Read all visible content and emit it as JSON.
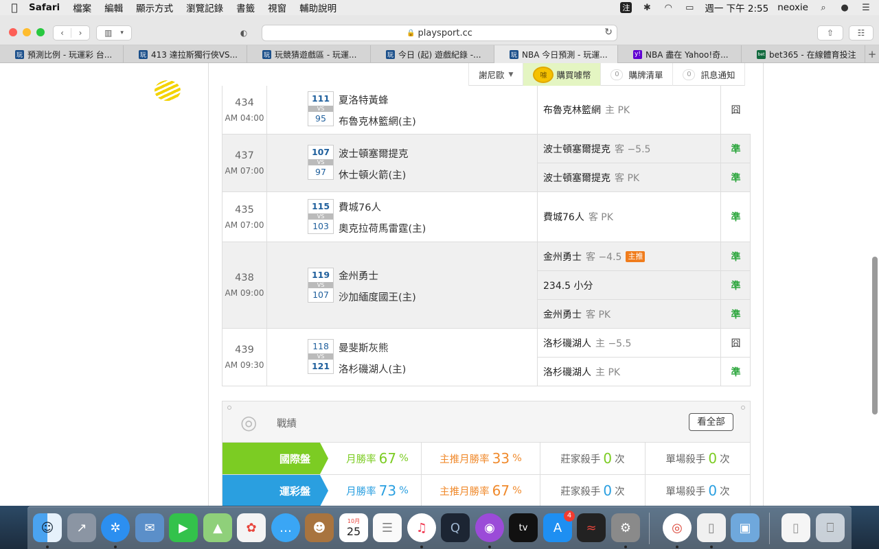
{
  "menubar": {
    "app": "Safari",
    "items": [
      "檔案",
      "編輯",
      "顯示方式",
      "瀏覽記錄",
      "書籤",
      "視窗",
      "輔助說明"
    ],
    "ime": "注",
    "clock": "週一 下午 2:55",
    "user": "neoxie"
  },
  "browser": {
    "url": "playsport.cc",
    "tabs": [
      {
        "title": "預測比例 - 玩運彩 台...",
        "fav": "玩"
      },
      {
        "title": "413 達拉斯獨行俠VS...",
        "fav": "玩"
      },
      {
        "title": "玩競猜遊戲區 - 玩運...",
        "fav": "玩"
      },
      {
        "title": "今日 (起) 遊戲紀錄 -...",
        "fav": "玩"
      },
      {
        "title": "NBA 今日預測 - 玩運...",
        "fav": "玩"
      },
      {
        "title": "NBA 盡在 Yahoo!奇...",
        "fav": "y!"
      },
      {
        "title": "bet365 - 在線體育投注",
        "fav": "bet"
      }
    ],
    "new_tab": "+"
  },
  "topnav": {
    "user": "謝尼歐",
    "buy": "購買噱幣",
    "coin": "噱",
    "cart_count": "0",
    "cart": "購牌清單",
    "msg_count": "0",
    "msg": "訊息通知"
  },
  "games": [
    {
      "no": "434",
      "time": "AM 04:00",
      "away_score": "111",
      "vs": "VS",
      "home_score": "95",
      "away": "夏洛特黃蜂",
      "home": "布魯克林籃網(主)",
      "picks": [
        {
          "team": "布魯克林籃網",
          "side": "主 PK",
          "result": "囧"
        }
      ]
    },
    {
      "no": "437",
      "time": "AM 07:00",
      "away_score": "107",
      "vs": "VS",
      "home_score": "97",
      "away": "波士頓塞爾提克",
      "home": "休士頓火箭(主)",
      "picks": [
        {
          "team": "波士頓塞爾提克",
          "side": "客 −5.5",
          "result": "準"
        },
        {
          "team": "波士頓塞爾提克",
          "side": "客 PK",
          "result": "準"
        }
      ]
    },
    {
      "no": "435",
      "time": "AM 07:00",
      "away_score": "115",
      "vs": "VS",
      "home_score": "103",
      "away": "費城76人",
      "home": "奧克拉荷馬雷霆(主)",
      "picks": [
        {
          "team": "費城76人",
          "side": "客 PK",
          "result": "準"
        }
      ]
    },
    {
      "no": "438",
      "time": "AM 09:00",
      "away_score": "119",
      "vs": "VS",
      "home_score": "107",
      "away": "金州勇士",
      "home": "沙加緬度國王(主)",
      "picks": [
        {
          "team": "金州勇士",
          "side": "客 −4.5",
          "badge": "主推",
          "result": "準"
        },
        {
          "team": "234.5 小分",
          "side": "",
          "result": "準"
        },
        {
          "team": "金州勇士",
          "side": "客 PK",
          "result": "準"
        }
      ]
    },
    {
      "no": "439",
      "time": "AM 09:30",
      "away_score": "118",
      "vs": "VS",
      "home_score": "121",
      "away": "曼斐斯灰熊",
      "home": "洛杉磯湖人(主)",
      "picks": [
        {
          "team": "洛杉磯湖人",
          "side": "主 −5.5",
          "result": "囧"
        },
        {
          "team": "洛杉磯湖人",
          "side": "主 PK",
          "result": "準"
        }
      ]
    }
  ],
  "record": {
    "title": "戰績",
    "see_all": "看全部",
    "rows": [
      {
        "label": "國際盤",
        "color": "#7ccc23",
        "month_label": "月勝率",
        "month": "67",
        "pct": "%",
        "main_label": "主推月勝率",
        "main": "33",
        "killer_label": "莊家殺手",
        "killer": "0",
        "times": "次",
        "single_label": "單場殺手",
        "single": "0"
      },
      {
        "label": "運彩盤",
        "color": "#2a9fe0",
        "month_label": "月勝率",
        "month": "73",
        "pct": "%",
        "main_label": "主推月勝率",
        "main": "67",
        "killer_label": "莊家殺手",
        "killer": "0",
        "times": "次",
        "single_label": "單場殺手",
        "single": "0"
      }
    ]
  },
  "dock": {
    "calendar_month": "10月",
    "calendar_day": "25",
    "appstore_badge": "4",
    "tv": "tv"
  }
}
